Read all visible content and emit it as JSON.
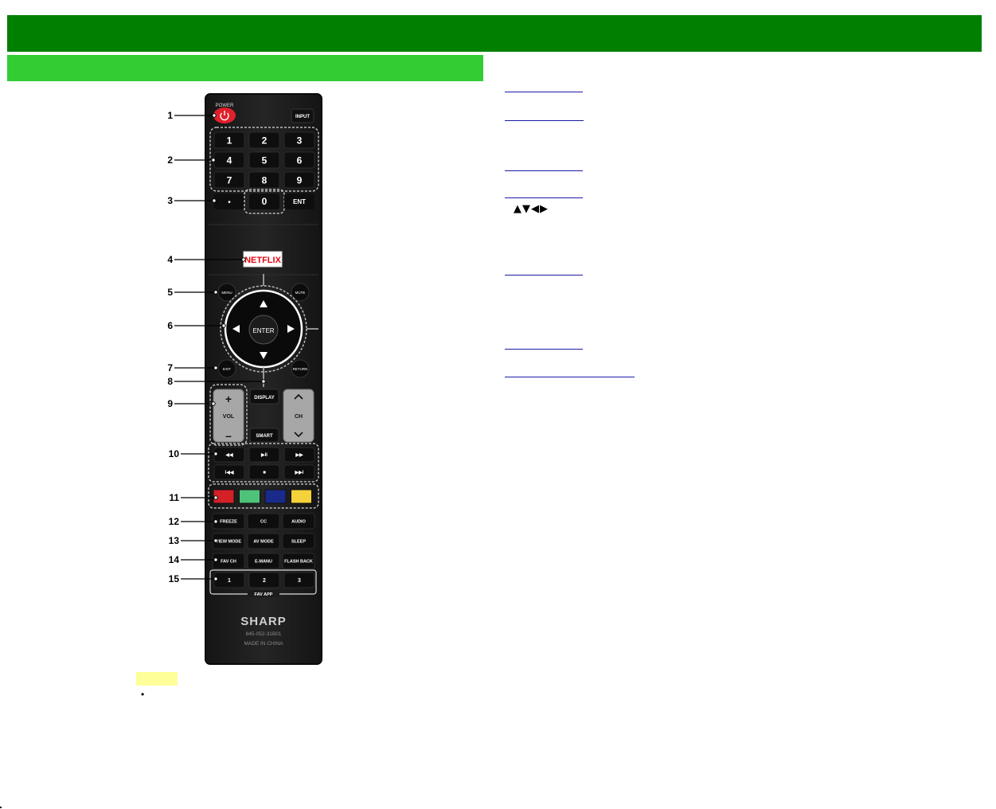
{
  "remote": {
    "power_label": "POWER",
    "input_label": "INPUT",
    "digits": [
      "1",
      "2",
      "3",
      "4",
      "5",
      "6",
      "7",
      "8",
      "9"
    ],
    "dot_label": "•",
    "zero_label": "0",
    "ent_label": "ENT",
    "netflix_label": "NETFLIX",
    "menu_label": "MENU",
    "mute_label": "MUTE",
    "enter_label": "ENTER",
    "exit_label": "EXIT",
    "return_label": "RETURN",
    "display_label": "DISPLAY",
    "vol_label": "VOL",
    "vol_plus": "+",
    "vol_minus": "–",
    "ch_label": "CH",
    "ch_up": "^",
    "ch_down": "v",
    "smart_label": "SMART",
    "playback_row1": [
      "◀◀",
      "▶II",
      "▶▶"
    ],
    "playback_row2": [
      "I◀◀",
      "■",
      "▶▶I"
    ],
    "freeze_label": "FREEZE",
    "cc_label": "CC",
    "audio_label": "AUDIO",
    "viewmode_label": "VIEW MODE",
    "avmode_label": "AV MODE",
    "sleep_label": "SLEEP",
    "favch_label": "FAV CH",
    "emanu_label": "E-MANU",
    "flashback_label": "FLASH BACK",
    "favapp_digits": [
      "1",
      "2",
      "3"
    ],
    "favapp_label": "FAV APP",
    "brand": "SHARP",
    "model": "845-052-31B01",
    "made_in": "MADE IN CHINA",
    "color_keys": [
      "#d42027",
      "#4fc27a",
      "#1a2a8a",
      "#f6d23a"
    ]
  },
  "callouts": [
    "1",
    "2",
    "3",
    "4",
    "5",
    "6",
    "7",
    "8",
    "9",
    "10",
    "11",
    "12",
    "13",
    "14",
    "15"
  ],
  "links_arrows": "▲▼◀▶",
  "colors": {
    "header": "#017f01",
    "subheader": "#33cc33",
    "note": "#ffff99",
    "link": "#1a1aa6"
  }
}
